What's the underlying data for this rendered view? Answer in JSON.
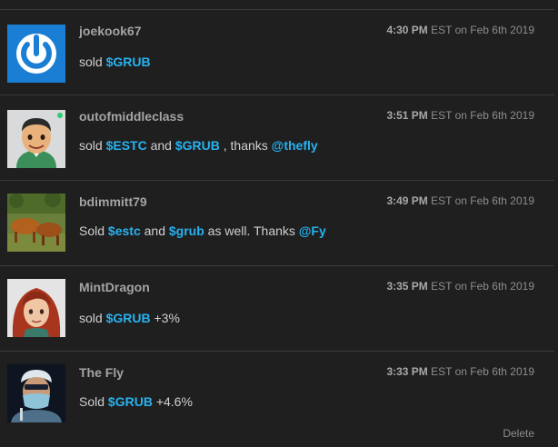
{
  "posts": [
    {
      "username": "joekook67",
      "time": "4:30 PM",
      "zone_date": " EST on Feb 6th 2019",
      "avatar_icon": "power-icon",
      "message": [
        {
          "kind": "text",
          "text": "sold "
        },
        {
          "kind": "link",
          "text": "$GRUB"
        }
      ]
    },
    {
      "username": "outofmiddleclass",
      "time": "3:51 PM",
      "zone_date": " EST on Feb 6th 2019",
      "avatar_icon": "cartoon-man-avatar",
      "message": [
        {
          "kind": "text",
          "text": "sold "
        },
        {
          "kind": "link",
          "text": "$ESTC"
        },
        {
          "kind": "text",
          "text": " and "
        },
        {
          "kind": "link",
          "text": "$GRUB"
        },
        {
          "kind": "text",
          "text": " , thanks "
        },
        {
          "kind": "link",
          "text": "@thefly"
        }
      ]
    },
    {
      "username": "bdimmitt79",
      "time": "3:49 PM",
      "zone_date": " EST on Feb 6th 2019",
      "avatar_icon": "cattle-photo-avatar",
      "message": [
        {
          "kind": "text",
          "text": "Sold "
        },
        {
          "kind": "link",
          "text": "$estc"
        },
        {
          "kind": "text",
          "text": " and "
        },
        {
          "kind": "link",
          "text": "$grub"
        },
        {
          "kind": "text",
          "text": " as well. Thanks "
        },
        {
          "kind": "link",
          "text": "@Fy"
        }
      ]
    },
    {
      "username": "MintDragon",
      "time": "3:35 PM",
      "zone_date": " EST on Feb 6th 2019",
      "avatar_icon": "redhead-avatar",
      "message": [
        {
          "kind": "text",
          "text": "sold "
        },
        {
          "kind": "link",
          "text": "$GRUB"
        },
        {
          "kind": "text",
          "text": " +3%"
        }
      ]
    },
    {
      "username": "The Fly",
      "time": "3:33 PM",
      "zone_date": " EST on Feb 6th 2019",
      "avatar_icon": "masked-doctor-avatar",
      "message": [
        {
          "kind": "text",
          "text": "Sold "
        },
        {
          "kind": "link",
          "text": "$GRUB"
        },
        {
          "kind": "text",
          "text": " +4.6%"
        }
      ]
    }
  ],
  "delete_label": "Delete",
  "colors": {
    "background": "#1f1f1f",
    "divider": "#3a3a3a",
    "link": "#27b2ef",
    "username": "#a4a4a4",
    "message": "#d0d0d0"
  }
}
